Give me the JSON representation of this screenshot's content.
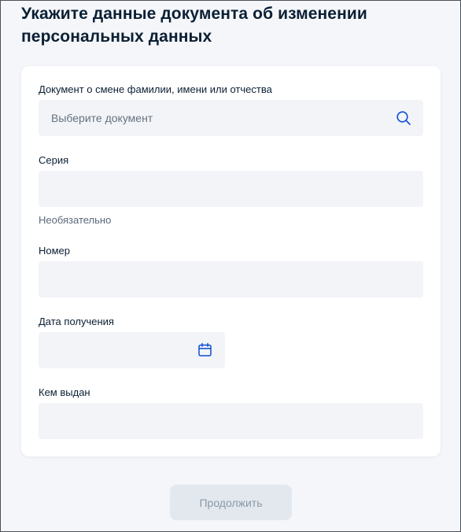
{
  "page": {
    "title": "Укажите данные документа об изменении персональных данных"
  },
  "form": {
    "document": {
      "label": "Документ о смене фамилии, имени или отчества",
      "placeholder": "Выберите документ",
      "icon": "search-icon"
    },
    "series": {
      "label": "Серия",
      "value": "",
      "hint": "Необязательно"
    },
    "number": {
      "label": "Номер",
      "value": ""
    },
    "issue_date": {
      "label": "Дата получения",
      "value": "",
      "icon": "calendar-icon"
    },
    "issued_by": {
      "label": "Кем выдан",
      "value": ""
    }
  },
  "actions": {
    "continue_label": "Продолжить"
  },
  "colors": {
    "accent": "#0d4cd3",
    "input_bg": "#f2f4f8",
    "page_bg": "#f4f6fa",
    "button_disabled_bg": "#e3e8ef",
    "button_disabled_text": "#8b97a5"
  }
}
